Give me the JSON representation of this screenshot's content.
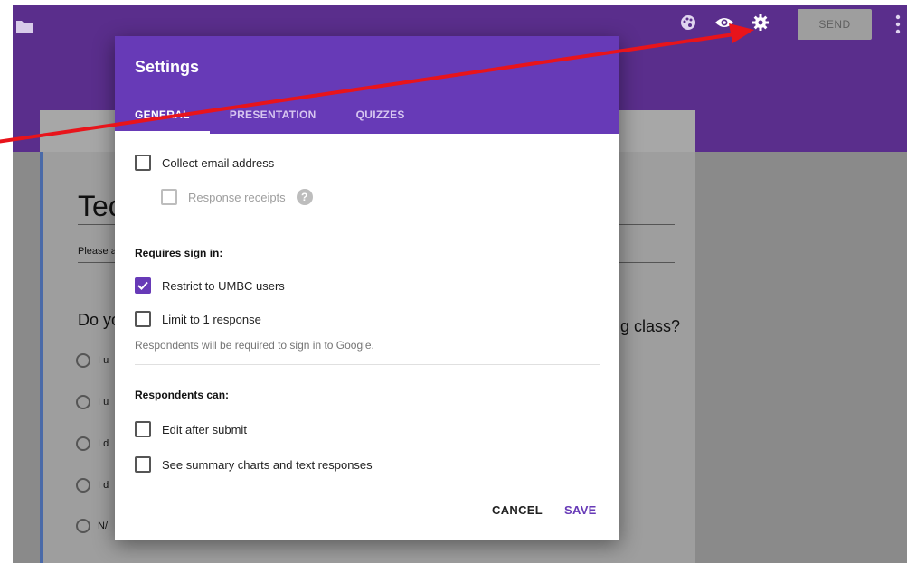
{
  "topbar": {
    "send_label": "SEND",
    "icons": [
      "folder-icon",
      "palette-icon",
      "eye-icon",
      "gear-icon",
      "more-vert-icon"
    ]
  },
  "form": {
    "title_fragment": "Tec",
    "description_fragment": "Please a",
    "question_start": "Do yo",
    "question_end": "g class?",
    "options": [
      "I u",
      "I u",
      "I d",
      "I d",
      "N/"
    ]
  },
  "dialog": {
    "title": "Settings",
    "tabs": [
      "GENERAL",
      "PRESENTATION",
      "QUIZZES"
    ],
    "active_tab": "GENERAL",
    "collect_email": "Collect email address",
    "response_receipts": "Response receipts",
    "requires_sign_in": "Requires sign in:",
    "restrict_users": "Restrict to UMBC users",
    "limit_response": "Limit to 1 response",
    "sign_in_note": "Respondents will be required to sign in to Google.",
    "respondents_can": "Respondents can:",
    "edit_after_submit": "Edit after submit",
    "see_summary": "See summary charts and text responses",
    "cancel": "CANCEL",
    "save": "SAVE",
    "checkboxes": {
      "collect_email": false,
      "response_receipts": false,
      "restrict_users": true,
      "limit_response": false,
      "edit_after_submit": false,
      "see_summary": false
    }
  },
  "colors": {
    "header": "#5a2e8c",
    "dialog_header": "#673ab7",
    "accent": "#673ab7",
    "arrow": "#e8141b"
  }
}
